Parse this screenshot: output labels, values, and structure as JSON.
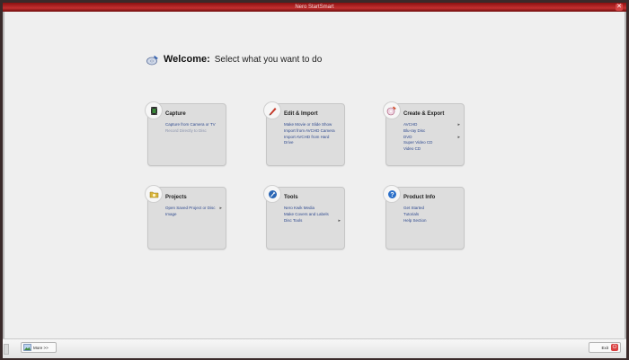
{
  "window": {
    "title": "Nero StartSmart",
    "close_glyph": "✕"
  },
  "welcome": {
    "bold": "Welcome:",
    "text": "Select what you want to do",
    "icon": "cd-burn-icon"
  },
  "cards": [
    {
      "id": "capture",
      "title": "Capture",
      "icon": "film-icon",
      "accent": "#3b8a3b",
      "items": [
        {
          "label": "Capture from Camera or TV",
          "disabled": false,
          "submenu": false
        },
        {
          "label": "Record Directly to Disc",
          "disabled": true,
          "submenu": false
        }
      ]
    },
    {
      "id": "edit-import",
      "title": "Edit & Import",
      "icon": "pen-icon",
      "accent": "#c63a2a",
      "items": [
        {
          "label": "Make Movie or Slide Show",
          "disabled": false,
          "submenu": false
        },
        {
          "label": "Import from AVCHD Camera",
          "disabled": false,
          "submenu": false
        },
        {
          "label": "Import AVCHD from Hard Drive",
          "disabled": false,
          "submenu": false
        }
      ]
    },
    {
      "id": "create-export",
      "title": "Create & Export",
      "icon": "disc-burn-icon",
      "accent": "#d2502a",
      "items": [
        {
          "label": "AVCHD",
          "disabled": false,
          "submenu": true
        },
        {
          "label": "Blu-ray Disc",
          "disabled": false,
          "submenu": false
        },
        {
          "label": "DVD",
          "disabled": false,
          "submenu": true
        },
        {
          "label": "Super Video CD",
          "disabled": false,
          "submenu": false
        },
        {
          "label": "Video CD",
          "disabled": false,
          "submenu": false
        }
      ]
    },
    {
      "id": "projects",
      "title": "Projects",
      "icon": "folder-icon",
      "accent": "#d8b43a",
      "items": [
        {
          "label": "Open Saved Project or Disc Image",
          "disabled": false,
          "submenu": true
        }
      ]
    },
    {
      "id": "tools",
      "title": "Tools",
      "icon": "wrench-icon",
      "accent": "#2a66b5",
      "items": [
        {
          "label": "Nero Kwik Media",
          "disabled": false,
          "submenu": false
        },
        {
          "label": "Make Covers and Labels",
          "disabled": false,
          "submenu": false
        },
        {
          "label": "Disc Tools",
          "disabled": false,
          "submenu": true
        }
      ]
    },
    {
      "id": "product-info",
      "title": "Product Info",
      "icon": "help-icon",
      "accent": "#2a6fc9",
      "items": [
        {
          "label": "Get Started",
          "disabled": false,
          "submenu": false
        },
        {
          "label": "Tutorials",
          "disabled": false,
          "submenu": false
        },
        {
          "label": "Help Section",
          "disabled": false,
          "submenu": false
        }
      ]
    }
  ],
  "taskbar": {
    "more_label": "More >>",
    "exit_label": "Exit",
    "exit_glyph": "⏻"
  },
  "arrow_glyph": "▸"
}
